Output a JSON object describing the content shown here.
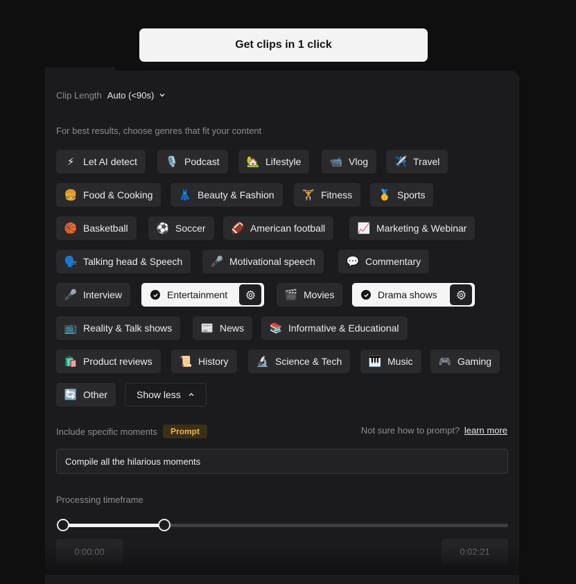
{
  "cta": {
    "label": "Get clips in 1 click"
  },
  "clip_length": {
    "label": "Clip Length",
    "value": "Auto (<90s)"
  },
  "genre_hint": "For best results, choose genres that fit your content",
  "genres": [
    {
      "label": "Let AI detect",
      "icon": "⚡",
      "icon_name": "lightning-icon"
    },
    {
      "label": "Podcast",
      "icon": "🎙️",
      "icon_name": "microphone-icon"
    },
    {
      "label": "Lifestyle",
      "icon": "🏡",
      "icon_name": "house-icon"
    },
    {
      "label": "Vlog",
      "icon": "📹",
      "icon_name": "video-camera-icon"
    },
    {
      "label": "Travel",
      "icon": "✈️",
      "icon_name": "airplane-icon"
    },
    {
      "label": "Food & Cooking",
      "icon": "🍔",
      "icon_name": "burger-icon"
    },
    {
      "label": "Beauty & Fashion",
      "icon": "👗",
      "icon_name": "dress-icon"
    },
    {
      "label": "Fitness",
      "icon": "🏋️",
      "icon_name": "weightlifter-icon"
    },
    {
      "label": "Sports",
      "icon": "🥇",
      "icon_name": "medal-icon"
    },
    {
      "label": "Basketball",
      "icon": "🏀",
      "icon_name": "basketball-icon"
    },
    {
      "label": "Soccer",
      "icon": "⚽",
      "icon_name": "soccer-ball-icon"
    },
    {
      "label": "American football",
      "icon": "🏈",
      "icon_name": "football-icon"
    },
    {
      "label": "Marketing & Webinar",
      "icon": "📈",
      "icon_name": "chart-increasing-icon"
    },
    {
      "label": "Talking head & Speech",
      "icon": "🗣️",
      "icon_name": "speaking-head-icon"
    },
    {
      "label": "Motivational speech",
      "icon": "🎤",
      "icon_name": "microphone-icon"
    },
    {
      "label": "Commentary",
      "icon": "💬",
      "icon_name": "speech-bubble-icon"
    },
    {
      "label": "Interview",
      "icon": "🎤",
      "icon_name": "microphone-icon"
    },
    {
      "label": "Entertainment",
      "selected": true
    },
    {
      "label": "Movies",
      "icon": "🎬",
      "icon_name": "clapper-board-icon"
    },
    {
      "label": "Drama shows",
      "selected": true
    },
    {
      "label": "Reality & Talk shows",
      "icon": "📺",
      "icon_name": "television-icon"
    },
    {
      "label": "News",
      "icon": "📰",
      "icon_name": "newspaper-icon"
    },
    {
      "label": "Informative & Educational",
      "icon": "📚",
      "icon_name": "books-icon"
    },
    {
      "label": "Product reviews",
      "icon": "🛍️",
      "icon_name": "shopping-bags-icon"
    },
    {
      "label": "History",
      "icon": "📜",
      "icon_name": "scroll-icon"
    },
    {
      "label": "Science & Tech",
      "icon": "🔬",
      "icon_name": "microscope-icon"
    },
    {
      "label": "Music",
      "icon": "🎹",
      "icon_name": "piano-keys-icon"
    },
    {
      "label": "Gaming",
      "icon": "🎮",
      "icon_name": "game-controller-icon"
    },
    {
      "label": "Other",
      "icon": "🔄",
      "icon_name": "refresh-icon"
    }
  ],
  "show_less": {
    "label": "Show less"
  },
  "moments": {
    "label": "Include specific moments",
    "badge": "Prompt",
    "help_text": "Not sure how to prompt?",
    "help_link": "learn more",
    "prompt_value": "Compile all the hilarious moments"
  },
  "timeframe": {
    "label": "Processing timeframe",
    "start": "0:00:00",
    "end": "0:02:21",
    "start_fraction": 0,
    "end_fraction": 0.227
  },
  "colors": {
    "accent_badge_text": "#f2b441",
    "accent_badge_bg": "#3a2f17",
    "chip_bg": "#2a2a2d",
    "selected_chip_bg": "#f5f5f6"
  }
}
